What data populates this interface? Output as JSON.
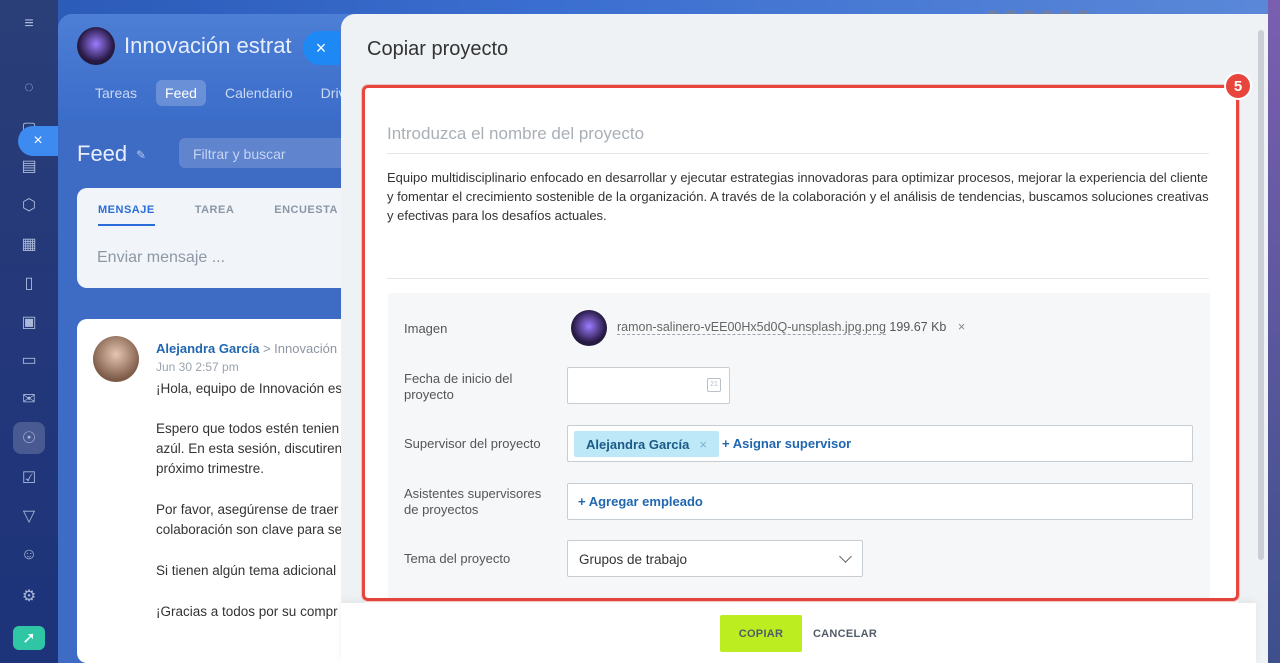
{
  "background": {
    "group_title": "Innovación estrat",
    "tabs": [
      "Tareas",
      "Feed",
      "Calendario",
      "Drive"
    ],
    "active_tab": "Feed",
    "feed_title": "Feed",
    "filter_placeholder": "Filtrar y buscar",
    "composer_tabs": [
      "MENSAJE",
      "TAREA",
      "ENCUESTA"
    ],
    "composer_placeholder": "Enviar mensaje ...",
    "post": {
      "author": "Alejandra García",
      "arrow": ">",
      "group": "Innovación",
      "date": "Jun 30 2:57 pm",
      "lines": [
        "¡Hola, equipo de Innovación es",
        "Espero que todos estén tenien",
        "azúl. En esta sesión, discutiren",
        "próximo trimestre.",
        "Por favor, asegúrense de traer",
        "colaboración son clave para se",
        "Si tienen algún tema adicional",
        "¡Gracias a todos por su compr"
      ]
    }
  },
  "panel": {
    "title": "Copiar proyecto",
    "step_badge": "5",
    "name_placeholder": "Introduzca el nombre del proyecto",
    "description": "Equipo multidisciplinario enfocado en desarrollar y ejecutar estrategias innovadoras para optimizar procesos, mejorar la experiencia del cliente y fomentar el crecimiento sostenible de la organización. A través de la colaboración y el análisis de tendencias, buscamos soluciones creativas y efectivas para los desafíos actuales.",
    "fields": {
      "image_label": "Imagen",
      "image_filename": "ramon-salinero-vEE00Hx5d0Q-unsplash.jpg.png",
      "image_size": "199.67 Kb",
      "image_remove": "×",
      "start_date_label": "Fecha de inicio del proyecto",
      "start_date_value": "",
      "supervisor_label": "Supervisor del proyecto",
      "supervisor_chip": "Alejandra García",
      "supervisor_chip_remove": "×",
      "assign_supervisor": "+ Asignar supervisor",
      "assistants_label": "Asistentes supervisores de proyectos",
      "add_employee": "+ Agregar empleado",
      "theme_label": "Tema del proyecto",
      "theme_value": "Grupos de trabajo"
    },
    "buttons": {
      "copy": "COPIAR",
      "cancel": "CANCELAR"
    }
  },
  "icons": {
    "close": "×",
    "pin": "✎"
  },
  "colors": {
    "accent_green": "#bbed21",
    "link_blue": "#2067b0",
    "highlight_red": "#e8453c",
    "chip_bg": "#bde8f8"
  }
}
